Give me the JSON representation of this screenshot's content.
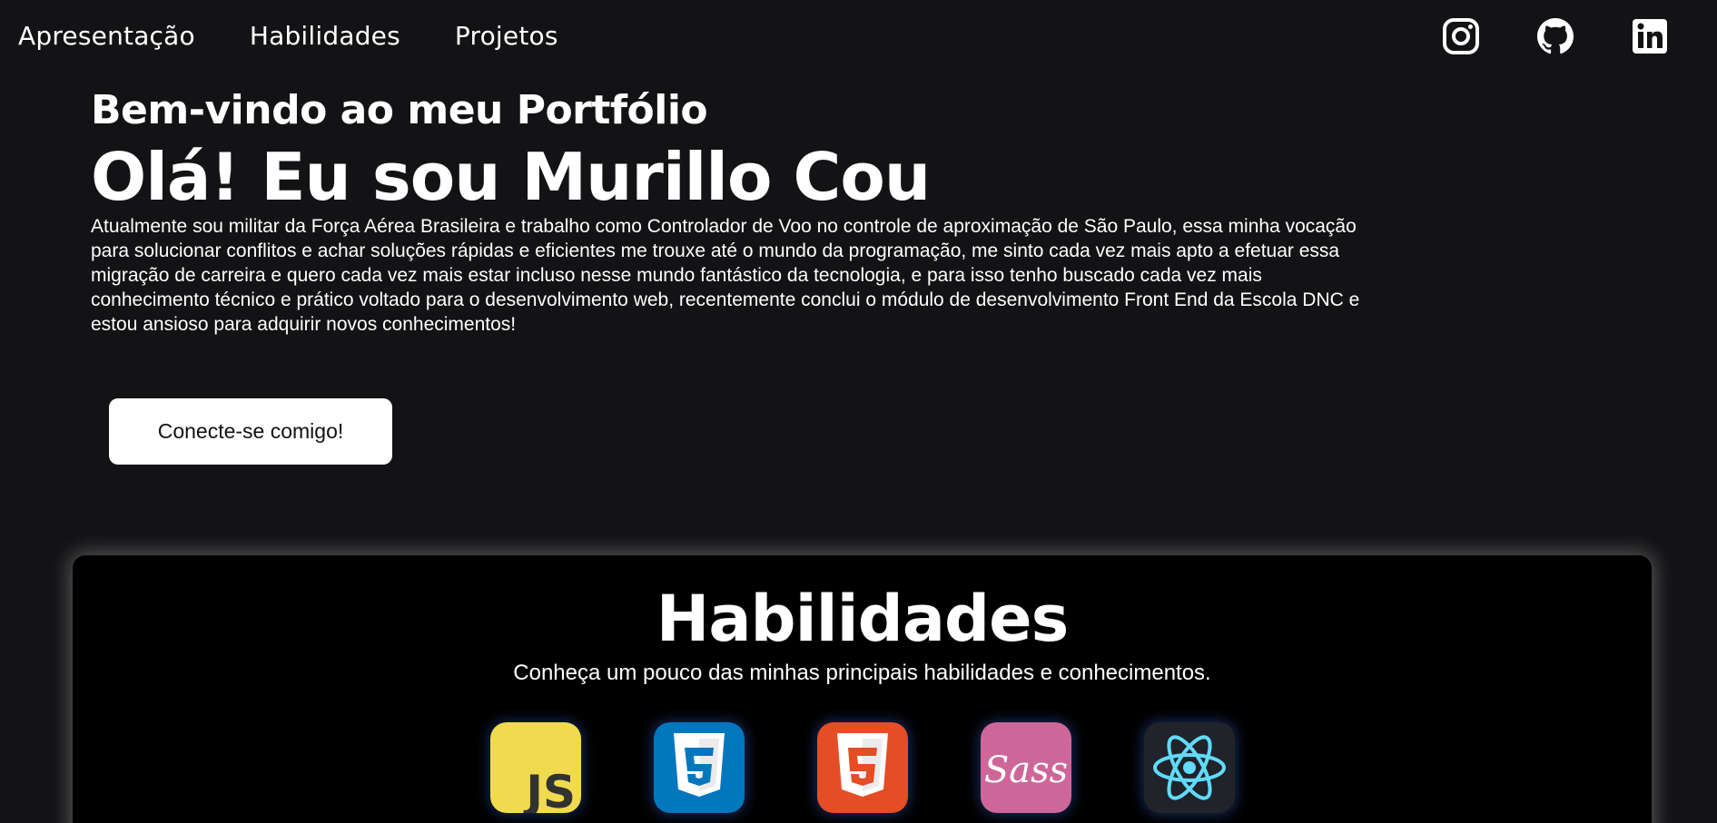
{
  "nav": {
    "links": [
      "Apresentação",
      "Habilidades",
      "Projetos"
    ]
  },
  "social": [
    "instagram-icon",
    "github-icon",
    "linkedin-icon"
  ],
  "hero": {
    "subtitle": "Bem-vindo ao meu Portfólio",
    "title": "Olá! Eu sou Murillo Cou",
    "description": "Atualmente sou militar da Força Aérea Brasileira e trabalho como Controlador de Voo no controle de aproximação de São Paulo, essa minha vocação para solucionar conflitos e achar soluções rápidas e eficientes me trouxe até o mundo da programação, me sinto cada vez mais apto a efetuar essa migração de carreira e quero cada vez mais estar incluso nesse mundo fantástico da tecnologia, e para isso tenho buscado cada vez mais conhecimento técnico e prático voltado para o desenvolvimento web, recentemente conclui o módulo de desenvolvimento Front End da Escola DNC e estou ansioso para adquirir novos conhecimentos!",
    "cta_label": "Conecte-se comigo!"
  },
  "skills": {
    "title": "Habilidades",
    "subtitle": "Conheça um pouco das minhas principais habilidades e conhecimentos.",
    "icons": [
      {
        "name": "javascript-icon",
        "label": "JS",
        "color": "#f0db4f"
      },
      {
        "name": "css3-icon",
        "label": "3",
        "color": "#0277bd"
      },
      {
        "name": "html5-icon",
        "label": "5",
        "color": "#e44d26"
      },
      {
        "name": "sass-icon",
        "label": "Sass",
        "color": "#cd6799"
      },
      {
        "name": "react-icon",
        "label": "",
        "color": "#20232a"
      }
    ]
  },
  "colors": {
    "background": "#131315",
    "card": "#000000",
    "text": "#ffffff",
    "react_accent": "#61dafb"
  }
}
